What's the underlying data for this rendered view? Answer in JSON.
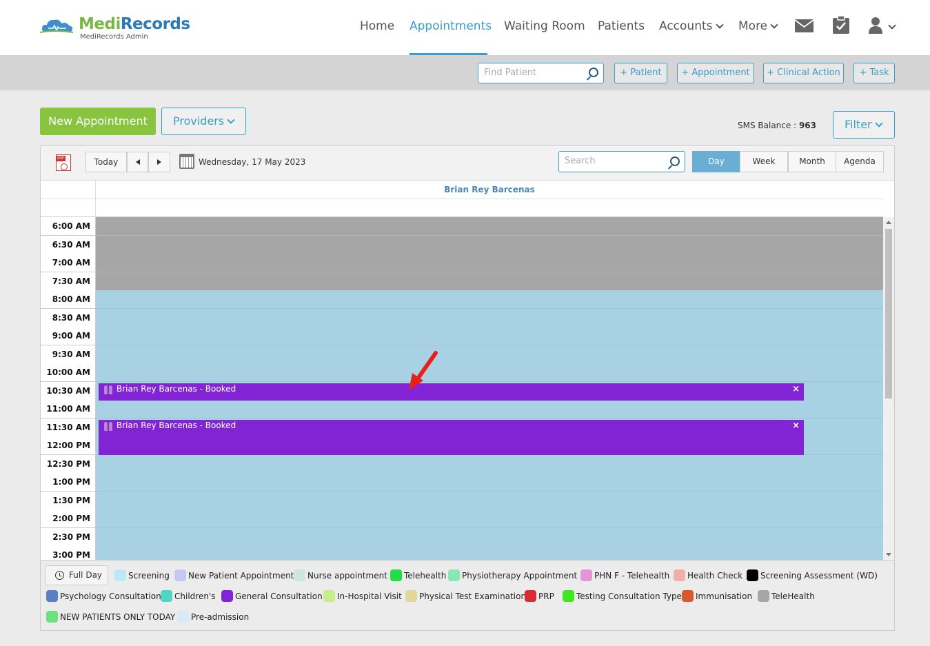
{
  "header": {
    "logo_name_1": "Medi",
    "logo_name_2": "Records",
    "logo_subtitle": "MediRecords Admin",
    "nav": [
      "Home",
      "Appointments",
      "Waiting Room",
      "Patients",
      "Accounts",
      "More"
    ],
    "active_nav": "Appointments"
  },
  "actionbar": {
    "find_placeholder": "Find Patient",
    "buttons": [
      "+ Patient",
      "+ Appointment",
      "+ Clinical Action",
      "+ Task"
    ]
  },
  "toolbar": {
    "new_appointment": "New Appointment",
    "providers": "Providers",
    "sms_label": "SMS Balance : ",
    "sms_value": "963",
    "filter": "Filter"
  },
  "calendar": {
    "today": "Today",
    "date": "Wednesday, 17 May 2023",
    "search_placeholder": "Search",
    "views": [
      "Day",
      "Week",
      "Month",
      "Agenda"
    ],
    "active_view": "Day",
    "provider": "Brian Rey Barcenas",
    "slots": [
      {
        "time": "6:00 AM",
        "status": "unavailable"
      },
      {
        "time": "6:30 AM",
        "status": "unavailable"
      },
      {
        "time": "7:00 AM",
        "status": "unavailable"
      },
      {
        "time": "7:30 AM",
        "status": "unavailable"
      },
      {
        "time": "8:00 AM",
        "status": "available"
      },
      {
        "time": "8:30 AM",
        "status": "available"
      },
      {
        "time": "9:00 AM",
        "status": "available"
      },
      {
        "time": "9:30 AM",
        "status": "available"
      },
      {
        "time": "10:00 AM",
        "status": "available"
      },
      {
        "time": "10:30 AM",
        "status": "available"
      },
      {
        "time": "11:00 AM",
        "status": "available"
      },
      {
        "time": "11:30 AM",
        "status": "available"
      },
      {
        "time": "12:00 PM",
        "status": "available"
      },
      {
        "time": "12:30 PM",
        "status": "available"
      },
      {
        "time": "1:00 PM",
        "status": "available"
      },
      {
        "time": "1:30 PM",
        "status": "available"
      },
      {
        "time": "2:00 PM",
        "status": "available"
      },
      {
        "time": "2:30 PM",
        "status": "available"
      },
      {
        "time": "3:00 PM",
        "status": "available"
      }
    ],
    "appointments": [
      {
        "label": "Brian Rey Barcenas - Booked",
        "start": "10:30 AM",
        "slots": 1,
        "color": "#8324d4"
      },
      {
        "label": "Brian Rey Barcenas - Booked",
        "start": "11:30 AM",
        "slots": 2,
        "color": "#8324d4"
      }
    ]
  },
  "legend": {
    "full_day": "Full Day",
    "items": [
      {
        "label": "Screening",
        "color": "#bde9f6"
      },
      {
        "label": "New Patient Appointment",
        "color": "#c7c7f4"
      },
      {
        "label": "Nurse appointment",
        "color": "#cfe6e0"
      },
      {
        "label": "Telehealth",
        "color": "#22dd44"
      },
      {
        "label": "Physiotherapy Appointment",
        "color": "#88e8b4"
      },
      {
        "label": "PHN F - Telehealth",
        "color": "#e695d8"
      },
      {
        "label": "Health Check",
        "color": "#f0b0aa"
      },
      {
        "label": "Screening Assessment (WD)",
        "color": "#000000"
      },
      {
        "label": "Psychology Consultation",
        "color": "#5b7fc4"
      },
      {
        "label": "Children's",
        "color": "#4fd6c4"
      },
      {
        "label": "General Consultation",
        "color": "#8324d4"
      },
      {
        "label": "In-Hospital Visit",
        "color": "#c6ee8c"
      },
      {
        "label": "Physical Test Examination",
        "color": "#e1d79c"
      },
      {
        "label": "PRP",
        "color": "#d72c34"
      },
      {
        "label": "Testing Consultation Type",
        "color": "#3ee81e"
      },
      {
        "label": "Immunisation",
        "color": "#d85a2c"
      },
      {
        "label": "TeleHealth",
        "color": "#a6a6a6"
      },
      {
        "label": "NEW PATIENTS ONLY TODAY",
        "color": "#6be27c"
      },
      {
        "label": "Pre-admission",
        "color": "#dbe9f6"
      }
    ]
  }
}
